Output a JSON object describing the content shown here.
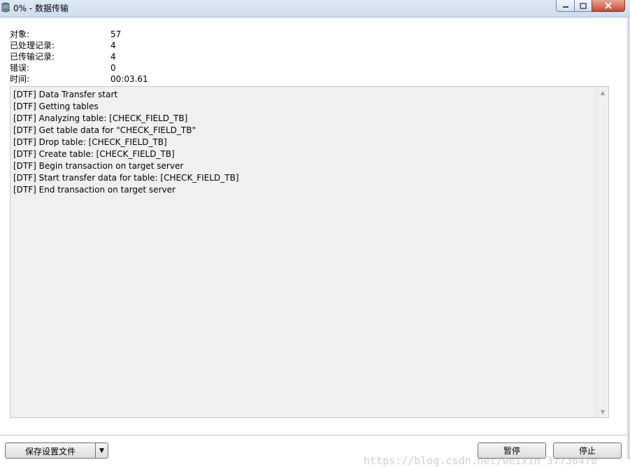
{
  "window": {
    "title": "0% - 数据传输",
    "icon": "database-transfer-icon",
    "controls": {
      "minimize": "minimize-icon",
      "maximize": "maximize-icon",
      "close": "close-icon"
    }
  },
  "stats": [
    {
      "label": "对象:",
      "value": "57"
    },
    {
      "label": "已处理记录:",
      "value": "4"
    },
    {
      "label": "已传输记录:",
      "value": "4"
    },
    {
      "label": "错误:",
      "value": "0"
    },
    {
      "label": "时间:",
      "value": "00:03.61"
    }
  ],
  "log": [
    "[DTF] Data Transfer start",
    "[DTF] Getting tables",
    "[DTF] Analyzing table: [CHECK_FIELD_TB]",
    "[DTF] Get table data for \"CHECK_FIELD_TB\"",
    "[DTF] Drop table: [CHECK_FIELD_TB]",
    "[DTF] Create table: [CHECK_FIELD_TB]",
    "[DTF] Begin transaction on target server",
    "[DTF] Start transfer data for table: [CHECK_FIELD_TB]",
    "[DTF] End transaction on target server"
  ],
  "buttons": {
    "save_settings": "保存设置文件",
    "pause": "暂停",
    "stop": "停止"
  },
  "watermark": "https://blog.csdn.net/weixin_37736470"
}
